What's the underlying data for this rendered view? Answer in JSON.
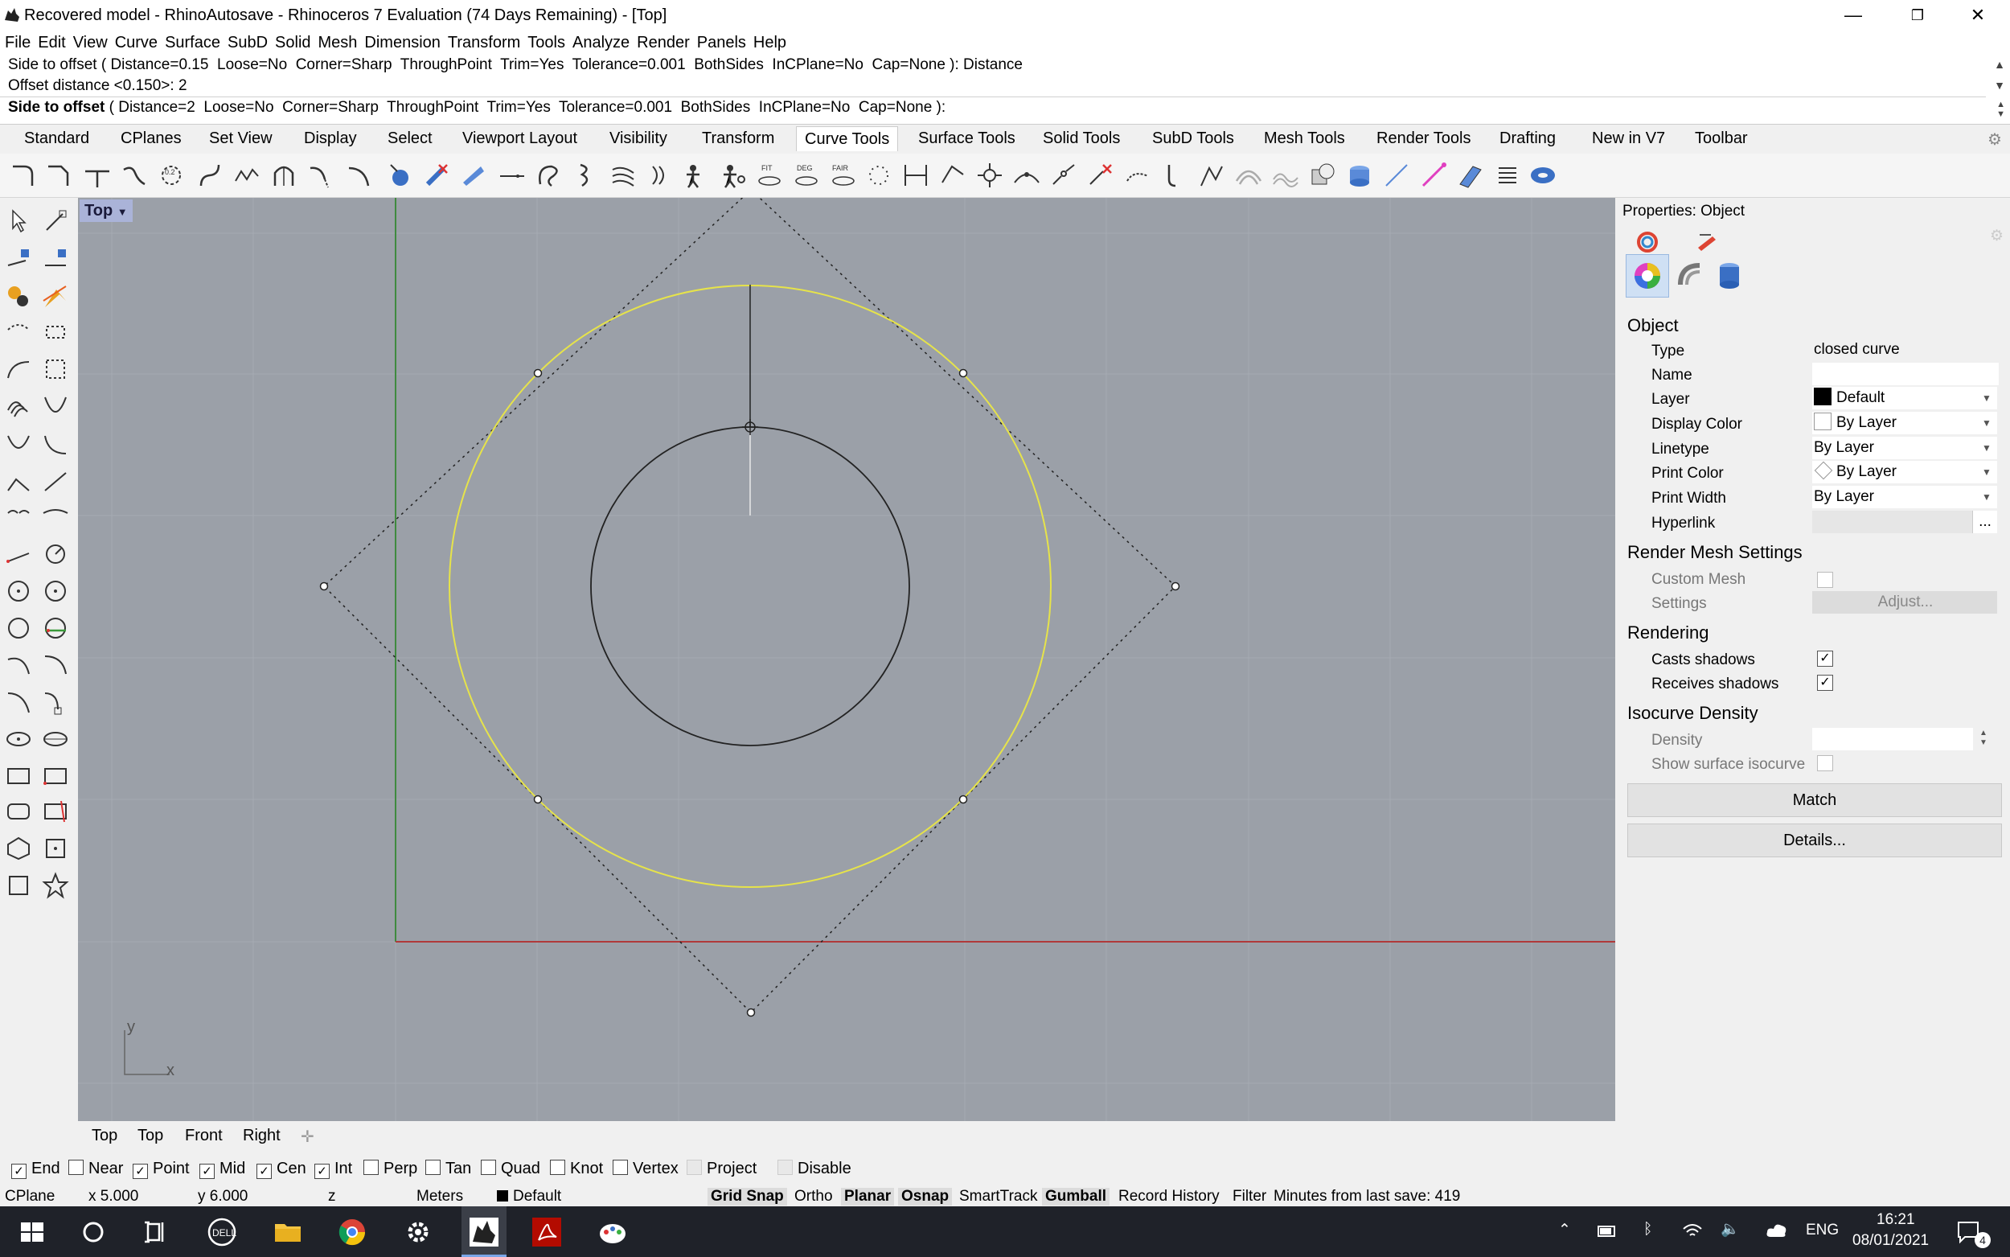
{
  "window": {
    "title": "Recovered model - RhinoAutosave - Rhinoceros 7 Evaluation (74 Days Remaining) - [Top]",
    "controls": [
      "—",
      "❐",
      "✕"
    ]
  },
  "menu": [
    "File",
    "Edit",
    "View",
    "Curve",
    "Surface",
    "SubD",
    "Solid",
    "Mesh",
    "Dimension",
    "Transform",
    "Tools",
    "Analyze",
    "Render",
    "Panels",
    "Help"
  ],
  "command": {
    "history_1": "Side to offset ( Distance=0.15  Loose=No  Corner=Sharp  ThroughPoint  Trim=Yes  Tolerance=0.001  BothSides  InCPlane=No  Cap=None ): Distance",
    "history_2": "Offset distance <0.150>: 2",
    "prompt_label": "Side to offset",
    "prompt_options": " ( Distance=2  Loose=No  Corner=Sharp  ThroughPoint  Trim=Yes  Tolerance=0.001  BothSides  InCPlane=No  Cap=None ):"
  },
  "tabs": [
    "Standard",
    "CPlanes",
    "Set View",
    "Display",
    "Select",
    "Viewport Layout",
    "Visibility",
    "Transform",
    "Curve Tools",
    "Surface Tools",
    "Solid Tools",
    "SubD Tools",
    "Mesh Tools",
    "Render Tools",
    "Drafting",
    "New in V7",
    "Toolbar"
  ],
  "active_tab": "Curve Tools",
  "viewport": {
    "label": "Top",
    "axis_x": "x",
    "axis_y": "y",
    "tabs": [
      "Top",
      "Top",
      "Front",
      "Right"
    ]
  },
  "properties": {
    "header": "Properties: Object",
    "section_object": "Object",
    "rows": {
      "type_label": "Type",
      "type_value": "closed curve",
      "name_label": "Name",
      "name_value": "",
      "layer_label": "Layer",
      "layer_value": "Default",
      "display_color_label": "Display Color",
      "display_color_value": "By Layer",
      "linetype_label": "Linetype",
      "linetype_value": "By Layer",
      "print_color_label": "Print Color",
      "print_color_value": "By Layer",
      "print_width_label": "Print Width",
      "print_width_value": "By Layer",
      "hyperlink_label": "Hyperlink",
      "hyperlink_button": "..."
    },
    "section_render_mesh": "Render Mesh Settings",
    "custom_mesh_label": "Custom Mesh",
    "settings_label": "Settings",
    "adjust_button": "Adjust...",
    "section_rendering": "Rendering",
    "casts_shadows_label": "Casts shadows",
    "casts_shadows": true,
    "receives_shadows_label": "Receives shadows",
    "receives_shadows": true,
    "section_isocurve": "Isocurve Density",
    "density_label": "Density",
    "show_isocurve_label": "Show surface isocurve",
    "match_button": "Match",
    "details_button": "Details..."
  },
  "osnaps": [
    {
      "label": "End",
      "checked": true
    },
    {
      "label": "Near",
      "checked": false
    },
    {
      "label": "Point",
      "checked": true
    },
    {
      "label": "Mid",
      "checked": true
    },
    {
      "label": "Cen",
      "checked": true
    },
    {
      "label": "Int",
      "checked": true
    },
    {
      "label": "Perp",
      "checked": false
    },
    {
      "label": "Tan",
      "checked": false
    },
    {
      "label": "Quad",
      "checked": false
    },
    {
      "label": "Knot",
      "checked": false
    },
    {
      "label": "Vertex",
      "checked": false
    },
    {
      "label": "Project",
      "checked": false,
      "disabled": true
    },
    {
      "label": "Disable",
      "checked": false,
      "disabled": true
    }
  ],
  "status": {
    "cplane": "CPlane",
    "x": "x 5.000",
    "y": "y 6.000",
    "z": "z",
    "units": "Meters",
    "layer": "Default",
    "grid_snap": "Grid Snap",
    "ortho": "Ortho",
    "planar": "Planar",
    "osnap": "Osnap",
    "smarttrack": "SmartTrack",
    "gumball": "Gumball",
    "record_history": "Record History",
    "filter": "Filter",
    "last_save": "Minutes from last save: 419"
  },
  "taskbar": {
    "lang": "ENG",
    "time": "16:21",
    "date": "08/01/2021",
    "notifications": "4"
  },
  "colors": {
    "viewport_bg": "#9ba0a8",
    "selected_curve": "#e6e34a",
    "x_axis": "#b03a3a",
    "y_axis": "#3f8a3f"
  }
}
